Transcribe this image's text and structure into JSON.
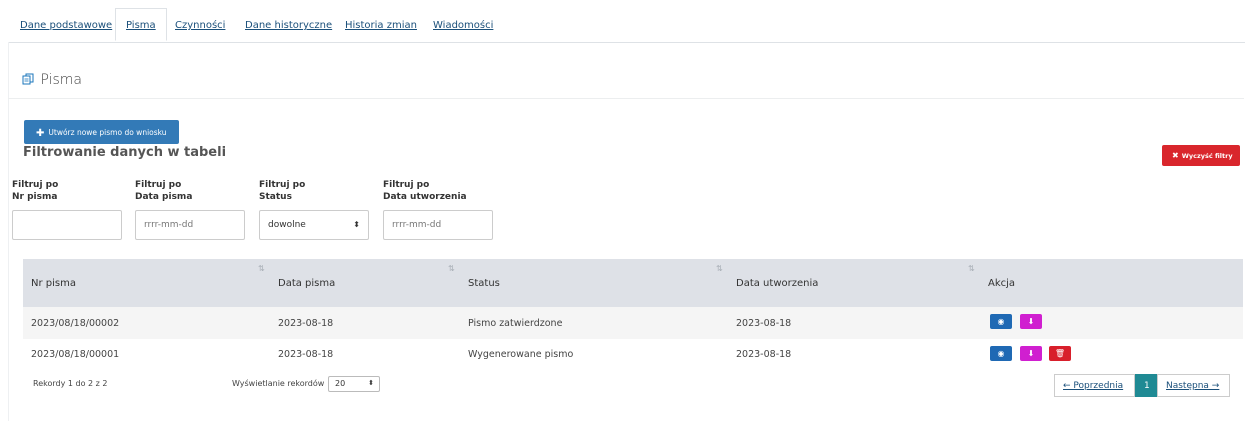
{
  "tabs": [
    {
      "label": "Dane podstawowe"
    },
    {
      "label": "Pisma"
    },
    {
      "label": "Czynności"
    },
    {
      "label": "Dane historyczne"
    },
    {
      "label": "Historia zmian"
    },
    {
      "label": "Wiadomości"
    }
  ],
  "active_tab": "Pisma",
  "section": {
    "icon": "documents-icon",
    "title": "Pisma"
  },
  "create_button": {
    "icon": "plus-icon",
    "label": "Utwórz nowe pismo do wniosku"
  },
  "filters": {
    "title": "Filtrowanie danych w tabeli",
    "clear_button": {
      "icon": "x-icon",
      "label": "Wyczyść filtry"
    },
    "fields": [
      {
        "label1": "Filtruj po",
        "label2": "Nr pisma",
        "value": "",
        "placeholder": ""
      },
      {
        "label1": "Filtruj po",
        "label2": "Data pisma",
        "value": "",
        "placeholder": "rrrr-mm-dd"
      },
      {
        "label1": "Filtruj po",
        "label2": "Status",
        "value": "dowolne",
        "placeholder": ""
      },
      {
        "label1": "Filtruj po",
        "label2": "Data utworzenia",
        "value": "",
        "placeholder": "rrrr-mm-dd"
      }
    ]
  },
  "table": {
    "columns": [
      "Nr pisma",
      "Data pisma",
      "Status",
      "Data utworzenia",
      "Akcja"
    ],
    "rows": [
      {
        "nr": "2023/08/18/00002",
        "date": "2023-08-18",
        "status": "Pismo zatwierdzone",
        "created": "2023-08-18",
        "actions": [
          "eye-icon",
          "download-icon"
        ]
      },
      {
        "nr": "2023/08/18/00001",
        "date": "2023-08-18",
        "status": "Wygenerowane pismo",
        "created": "2023-08-18",
        "actions": [
          "eye-icon",
          "download-icon",
          "trash-icon"
        ]
      }
    ]
  },
  "footer": {
    "records_info": "Rekordy 1 do 2 z 2",
    "page_length_label": "Wyświetlanie rekordów",
    "page_length_value": "20",
    "prev_label": "← Poprzednia",
    "current_page": "1",
    "next_label": "Następna →"
  },
  "colors": {
    "primary": "#337ab7",
    "danger": "#d9262c",
    "view": "#1f69b4",
    "download": "#d01fd0",
    "active_page": "#1f8a94"
  }
}
